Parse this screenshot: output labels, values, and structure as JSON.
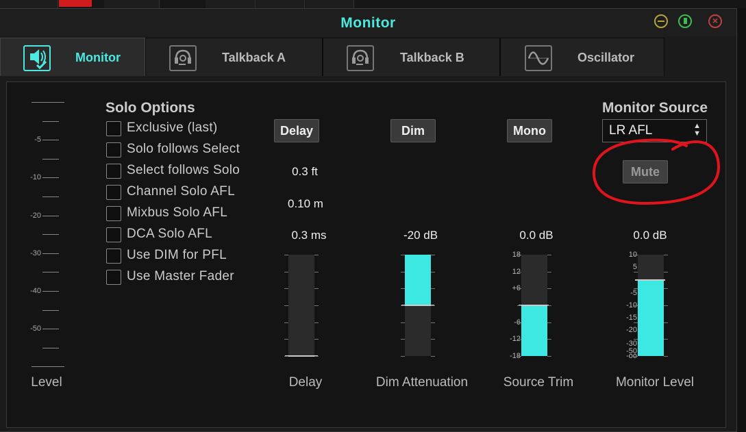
{
  "window": {
    "title": "Monitor"
  },
  "tabs": [
    {
      "label": "Monitor",
      "icon": "speaker-check-icon",
      "active": true
    },
    {
      "label": "Talkback A",
      "icon": "headset-icon",
      "active": false
    },
    {
      "label": "Talkback B",
      "icon": "headset-icon",
      "active": false
    },
    {
      "label": "Oscillator",
      "icon": "sine-wave-icon",
      "active": false
    }
  ],
  "level_meter": {
    "ticks": [
      "-5",
      "-10",
      "-20",
      "-30",
      "-40",
      "-50"
    ],
    "label": "Level"
  },
  "solo_options": {
    "title": "Solo Options",
    "items": [
      {
        "label": "Exclusive (last)",
        "checked": false
      },
      {
        "label": "Solo follows Select",
        "checked": false
      },
      {
        "label": "Select follows Solo",
        "checked": false
      },
      {
        "label": "Channel Solo AFL",
        "checked": false
      },
      {
        "label": "Mixbus Solo AFL",
        "checked": false
      },
      {
        "label": "DCA Solo AFL",
        "checked": false
      },
      {
        "label": "Use DIM for PFL",
        "checked": false
      },
      {
        "label": "Use Master Fader",
        "checked": false
      }
    ]
  },
  "delay": {
    "button": "Delay",
    "feet": "0.3 ft",
    "meters": "0.10 m",
    "ms": "0.3 ms",
    "label": "Delay",
    "fill_fraction": 0.0
  },
  "dim": {
    "button": "Dim",
    "value": "-20 dB",
    "label": "Dim Attenuation",
    "fill_fraction": 0.5
  },
  "mono": {
    "button": "Mono",
    "value": "0.0 dB",
    "label": "Source Trim",
    "scale": [
      "18",
      "12",
      "+6",
      "-6",
      "-12",
      "-18"
    ],
    "fill_fraction": 0.5
  },
  "monitor_source": {
    "title": "Monitor Source",
    "selected": "LR AFL",
    "mute_button": "Mute",
    "value": "0.0 dB",
    "label": "Monitor Level",
    "scale": [
      "10",
      "5",
      "-5",
      "-10",
      "-15",
      "-20",
      "-30",
      "-50",
      "-oo"
    ],
    "fill_fraction": 0.75
  },
  "colors": {
    "accent": "#4de8e0",
    "fader_fill": "#3ee8e2",
    "annotation": "#e0141c"
  }
}
